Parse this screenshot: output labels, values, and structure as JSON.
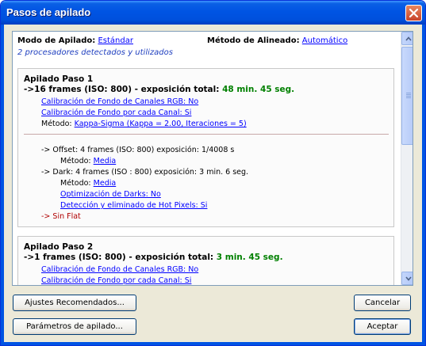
{
  "window": {
    "title": "Pasos de apilado"
  },
  "header": {
    "mode_label": "Modo de Apilado:",
    "mode_value": "Estándar",
    "align_label": "Método de Alineado:",
    "align_value": "Automático",
    "processors": "2 procesadores detectados y utilizados"
  },
  "steps": [
    {
      "title": "Apilado Paso 1",
      "frames_text": "->16 frames (ISO: 800) - exposición total:",
      "total_exposure": "48 min. 45 seg.",
      "calib_rgb": "Calibración de Fondo de Canales RGB: No",
      "calib_channel": "Calibración de Fondo por cada Canal: Si",
      "method_label": "Método:",
      "method_value": "Kappa-Sigma (Kappa = 2.00, Iteraciones = 5)",
      "offset_line": "-> Offset: 4 frames (ISO: 800) exposición: 1/4008 s",
      "offset_method_label": "Método:",
      "offset_method_value": "Media",
      "dark_line": "-> Dark: 4 frames (ISO : 800) exposición: 3 min. 6 seg.",
      "dark_method_label": "Método:",
      "dark_method_value": "Media",
      "dark_optimization": "Optimización de Darks: No",
      "hot_pixels": "Detección y eliminado de Hot Pixels: Si",
      "flat_line": "-> Sin Flat"
    },
    {
      "title": "Apilado Paso 2",
      "frames_text": "->1 frames (ISO: 800) - exposición total:",
      "total_exposure": "3 min. 45 seg.",
      "calib_rgb": "Calibración de Fondo de Canales RGB: No",
      "calib_channel": "Calibración de Fondo por cada Canal: Si"
    }
  ],
  "buttons": {
    "recommended": "Ajustes Recomendados...",
    "parameters": "Parámetros de apilado...",
    "cancel": "Cancelar",
    "accept": "Aceptar"
  },
  "colors": {
    "titlebar": "#0054e3",
    "link": "#0000ff",
    "exposure_green": "#008000",
    "arrow_red": "#b00000"
  }
}
